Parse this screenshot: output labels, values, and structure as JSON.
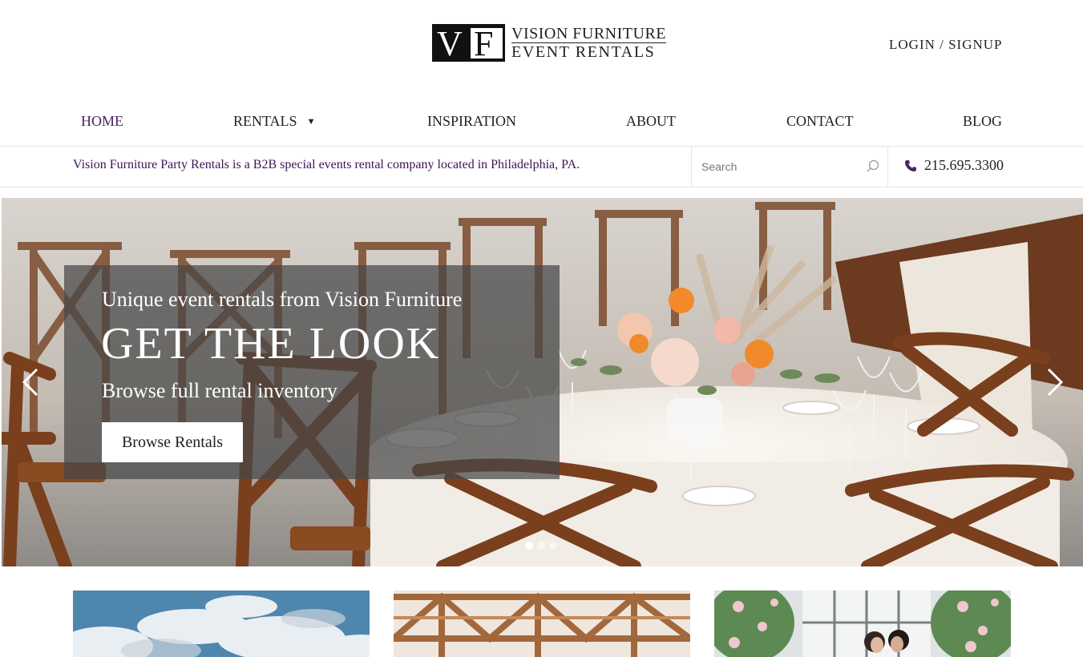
{
  "logo": {
    "mark": "VF",
    "mark_v": "V",
    "mark_f": "F",
    "line1": "VISION FURNITURE",
    "line2": "EVENT RENTALS"
  },
  "header": {
    "login_label": "LOGIN / SIGNUP"
  },
  "nav": {
    "items": [
      {
        "label": "HOME",
        "active": true
      },
      {
        "label": "RENTALS",
        "has_dropdown": true
      },
      {
        "label": "INSPIRATION"
      },
      {
        "label": "ABOUT"
      },
      {
        "label": "CONTACT"
      },
      {
        "label": "BLOG"
      }
    ],
    "caret": "▼"
  },
  "infobar": {
    "tagline": "Vision Furniture Party Rentals is a B2B special events rental company located in Philadelphia, PA.",
    "search_placeholder": "Search",
    "phone": "215.695.3300"
  },
  "hero": {
    "kicker": "Unique event rentals from Vision Furniture",
    "title": "GET THE LOOK",
    "subtitle": "Browse full rental inventory",
    "button_label": "Browse Rentals",
    "slides": {
      "count": 3,
      "active_index": 0
    }
  },
  "colors": {
    "brand_purple": "#4b2361",
    "tagline_purple": "#3d1456",
    "overlay": "rgba(70,70,70,0.72)"
  },
  "icons": {
    "search": "search-icon",
    "phone": "phone-icon",
    "prev": "chevron-left-icon",
    "next": "chevron-right-icon"
  }
}
